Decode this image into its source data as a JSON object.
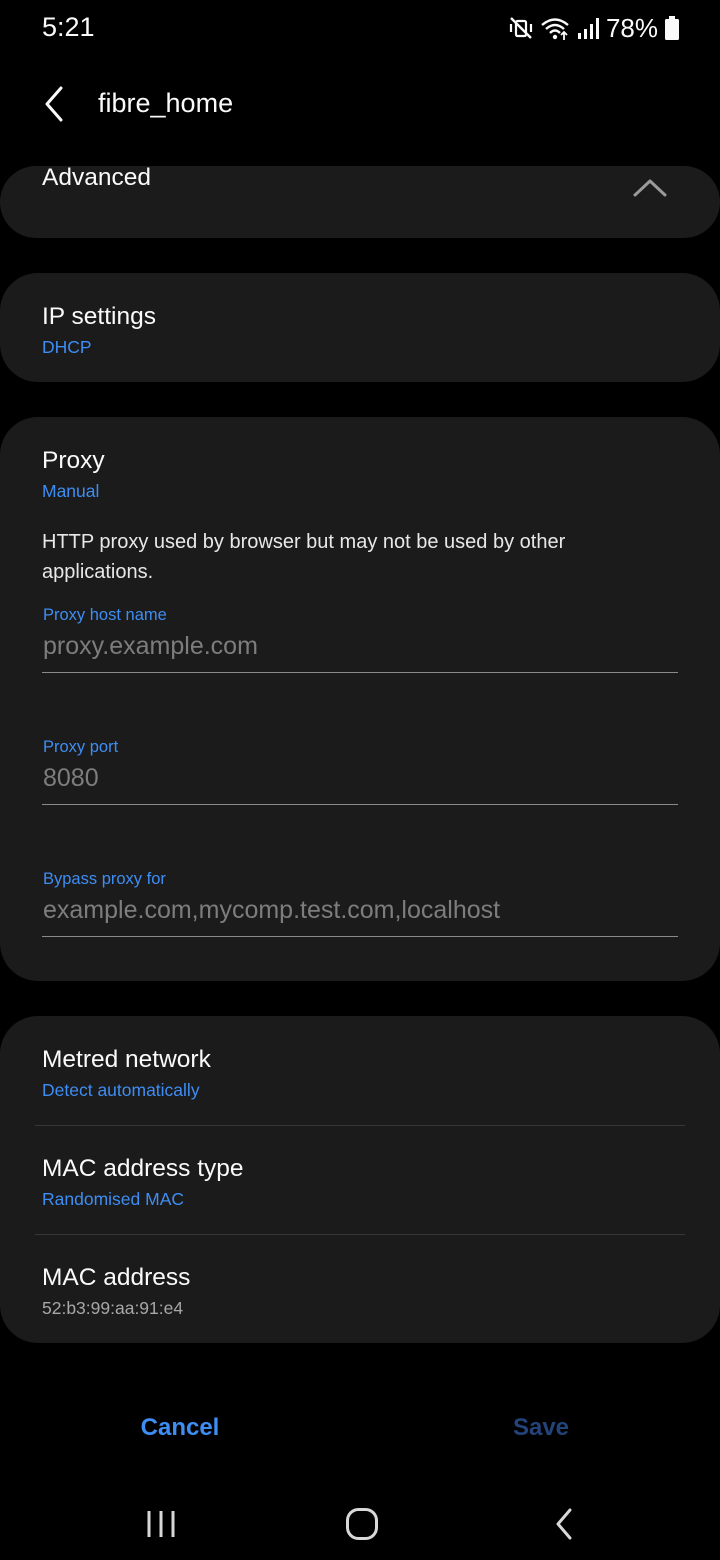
{
  "status": {
    "time": "5:21",
    "battery": "78%"
  },
  "header": {
    "title": "fibre_home"
  },
  "advanced": {
    "title": "Advanced"
  },
  "ip_settings": {
    "title": "IP settings",
    "value": "DHCP"
  },
  "proxy": {
    "title": "Proxy",
    "value": "Manual",
    "description": "HTTP proxy used by browser but may not be used by other applications.",
    "host_label": "Proxy host name",
    "host_placeholder": "proxy.example.com",
    "port_label": "Proxy port",
    "port_placeholder": "8080",
    "bypass_label": "Bypass proxy for",
    "bypass_placeholder": "example.com,mycomp.test.com,localhost"
  },
  "metred": {
    "title": "Metred network",
    "value": "Detect automatically"
  },
  "mac_type": {
    "title": "MAC address type",
    "value": "Randomised MAC"
  },
  "mac_address": {
    "title": "MAC address",
    "value": "52:b3:99:aa:91:e4"
  },
  "actions": {
    "cancel": "Cancel",
    "save": "Save"
  },
  "colors": {
    "accent": "#3e8df3",
    "card": "#1b1b1b",
    "background": "#000000",
    "save_disabled": "#23437a"
  }
}
